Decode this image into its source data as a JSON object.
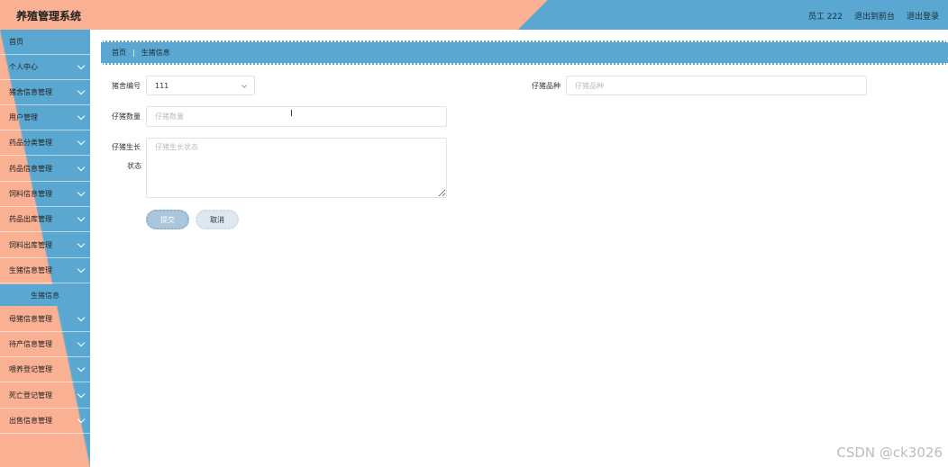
{
  "header": {
    "title": "养殖管理系统",
    "user": "员工 222",
    "front": "退出到前台",
    "logout": "退出登录"
  },
  "sidebar": {
    "items": [
      {
        "label": "首页"
      },
      {
        "label": "个人中心"
      },
      {
        "label": "猪舍信息管理"
      },
      {
        "label": "用户管理"
      },
      {
        "label": "药品分类管理"
      },
      {
        "label": "药品信息管理"
      },
      {
        "label": "饲料信息管理"
      },
      {
        "label": "药品出库管理"
      },
      {
        "label": "饲料出库管理"
      },
      {
        "label": "生猪信息管理"
      },
      {
        "label": "母猪信息管理"
      },
      {
        "label": "待产信息管理"
      },
      {
        "label": "喂养登记管理"
      },
      {
        "label": "死亡登记管理"
      },
      {
        "label": "出售信息管理"
      }
    ],
    "active_sub": "生猪信息"
  },
  "breadcrumb": {
    "home": "首页",
    "sep": "|",
    "current": "生猪信息"
  },
  "form": {
    "pen_label": "猪舍编号",
    "pen_value": "111",
    "breed_label": "仔猪品种",
    "breed_placeholder": "仔猪品种",
    "count_label": "仔猪数量",
    "count_placeholder": "仔猪数量",
    "growth_label_1": "仔猪生长",
    "growth_label_2": "状态",
    "growth_placeholder": "仔猪生长状态",
    "submit": "提交",
    "cancel": "取消"
  },
  "watermark": "CSDN @ck3026"
}
